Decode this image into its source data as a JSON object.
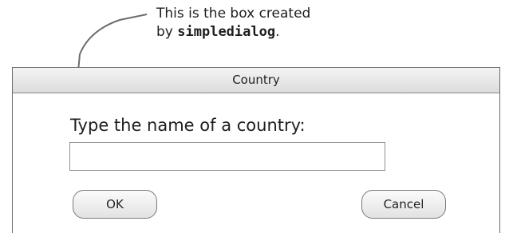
{
  "annotation": {
    "line1": "This is the box created",
    "line2_prefix": "by ",
    "line2_code": "simpledialog",
    "line2_suffix": "."
  },
  "dialog": {
    "title": "Country",
    "prompt": "Type the name of a country:",
    "input_value": "",
    "ok_label": "OK",
    "cancel_label": "Cancel"
  }
}
